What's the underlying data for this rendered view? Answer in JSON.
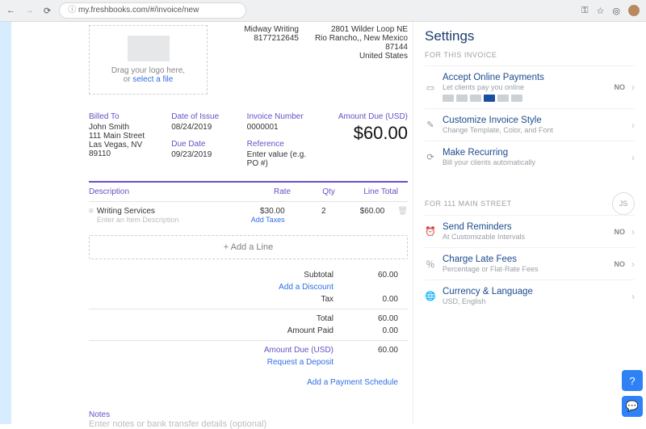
{
  "browser": {
    "url": "my.freshbooks.com/#/invoice/new"
  },
  "logo_drop": {
    "line1": "Drag your logo here,",
    "line2_prefix": "or ",
    "link": "select a file"
  },
  "company": {
    "name": "Midway Writing",
    "phone": "8177212645",
    "addr1": "2801 Wilder Loop NE",
    "addr2": "Rio Rancho,, New Mexico",
    "postal": "87144",
    "country": "United States"
  },
  "meta": {
    "billed_to_label": "Billed To",
    "billed_to": {
      "name": "John Smith",
      "street": "111 Main Street",
      "city": "Las Vegas, NV",
      "zip": "89110"
    },
    "date_issue_label": "Date of Issue",
    "date_issue": "08/24/2019",
    "due_date_label": "Due Date",
    "due_date": "09/23/2019",
    "invoice_no_label": "Invoice Number",
    "invoice_no": "0000001",
    "reference_label": "Reference",
    "reference_ph": "Enter value (e.g. PO #)",
    "amount_due_label": "Amount Due (USD)",
    "amount_due": "$60.00"
  },
  "columns": {
    "desc": "Description",
    "rate": "Rate",
    "qty": "Qty",
    "total": "Line Total"
  },
  "lines": [
    {
      "desc": "Writing Services",
      "desc_ph": "Enter an Item Description",
      "rate": "$30.00",
      "add_taxes": "Add Taxes",
      "qty": "2",
      "total": "$60.00"
    }
  ],
  "add_line": "+ Add a Line",
  "totals": {
    "subtotal_label": "Subtotal",
    "subtotal": "60.00",
    "add_discount": "Add a Discount",
    "tax_label": "Tax",
    "tax": "0.00",
    "total_label": "Total",
    "total": "60.00",
    "paid_label": "Amount Paid",
    "paid": "0.00",
    "due_label": "Amount Due (USD)",
    "due": "60.00",
    "deposit": "Request a Deposit",
    "schedule": "Add a Payment Schedule"
  },
  "notes": {
    "label": "Notes",
    "ph": "Enter notes or bank transfer details (optional)"
  },
  "sidebar": {
    "title": "Settings",
    "section1": "FOR THIS INVOICE",
    "accept": {
      "title": "Accept Online Payments",
      "sub": "Let clients pay you online",
      "state": "NO"
    },
    "style": {
      "title": "Customize Invoice Style",
      "sub": "Change Template, Color, and Font"
    },
    "recur": {
      "title": "Make Recurring",
      "sub": "Bill your clients automatically"
    },
    "section2": "FOR 111 MAIN STREET",
    "client_initials": "JS",
    "remind": {
      "title": "Send Reminders",
      "sub": "At Customizable Intervals",
      "state": "NO"
    },
    "late": {
      "title": "Charge Late Fees",
      "sub": "Percentage or Flat-Rate Fees",
      "state": "NO"
    },
    "curr": {
      "title": "Currency & Language",
      "sub": "USD, English"
    }
  }
}
